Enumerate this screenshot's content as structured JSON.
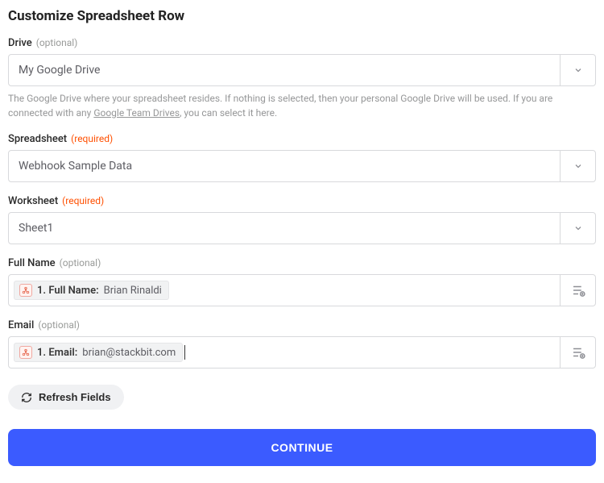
{
  "heading": "Customize Spreadsheet Row",
  "fields": {
    "drive": {
      "label": "Drive",
      "qualifier": "(optional)",
      "value": "My Google Drive",
      "help_pre": "The Google Drive where your spreadsheet resides. If nothing is selected, then your personal Google Drive will be used. If you are connected with any ",
      "help_link": "Google Team Drives",
      "help_post": ", you can select it here."
    },
    "spreadsheet": {
      "label": "Spreadsheet",
      "qualifier": "(required)",
      "value": "Webhook Sample Data"
    },
    "worksheet": {
      "label": "Worksheet",
      "qualifier": "(required)",
      "value": "Sheet1"
    },
    "full_name": {
      "label": "Full Name",
      "qualifier": "(optional)",
      "token_label": "1. Full Name:",
      "token_value": "Brian Rinaldi"
    },
    "email": {
      "label": "Email",
      "qualifier": "(optional)",
      "token_label": "1. Email:",
      "token_value": "brian@stackbit.com"
    }
  },
  "buttons": {
    "refresh": "Refresh Fields",
    "continue": "CONTINUE"
  }
}
